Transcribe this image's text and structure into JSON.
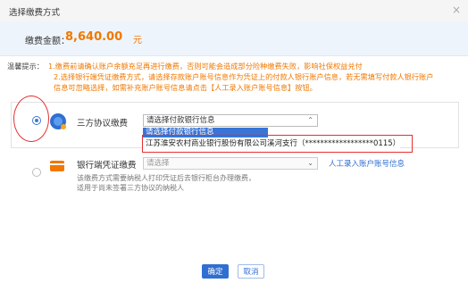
{
  "window": {
    "title": "选择缴费方式",
    "close_icon": "×"
  },
  "amount": {
    "label": "缴费金额：",
    "value": "8,640.00",
    "unit": "元"
  },
  "notice": {
    "title": "温馨提示：",
    "line1": "1.缴费前请确认账户余额充足再进行缴费，否则可能会造成部分险种缴费失败，影响社保权益兑付",
    "line2": "2.选择银行端凭证缴费方式，请选择存款账户账号信息作为凭证上的付款人银行账户信息，若无需填写付款人银行账户",
    "line3": "信息可忽略选择，如需补充账户账号信息请点击【人工录入账户账号信息】按钮。"
  },
  "option1": {
    "label": "三方协议缴费",
    "select_placeholder": "请选择付款银行信息",
    "arrow": "⌃",
    "dropdown_highlight": "请选择付款银行信息",
    "dropdown_item": "江苏淮安农村商业银行股份有限公司溪河支行（******************0115）"
  },
  "option2": {
    "label": "银行端凭证缴费",
    "select_placeholder": "请选择",
    "arrow": "⌄",
    "link": "人工录入账户账号信息",
    "desc1": "该缴费方式需要纳税人打印凭证后去银行柜台办理缴费，",
    "desc2": "适用于尚未签署三方协议的纳税人"
  },
  "buttons": {
    "confirm": "确定",
    "cancel": "取消"
  },
  "colors": {
    "accent": "#2f6fd1",
    "amount": "#f07800",
    "annotation": "#e53030"
  }
}
